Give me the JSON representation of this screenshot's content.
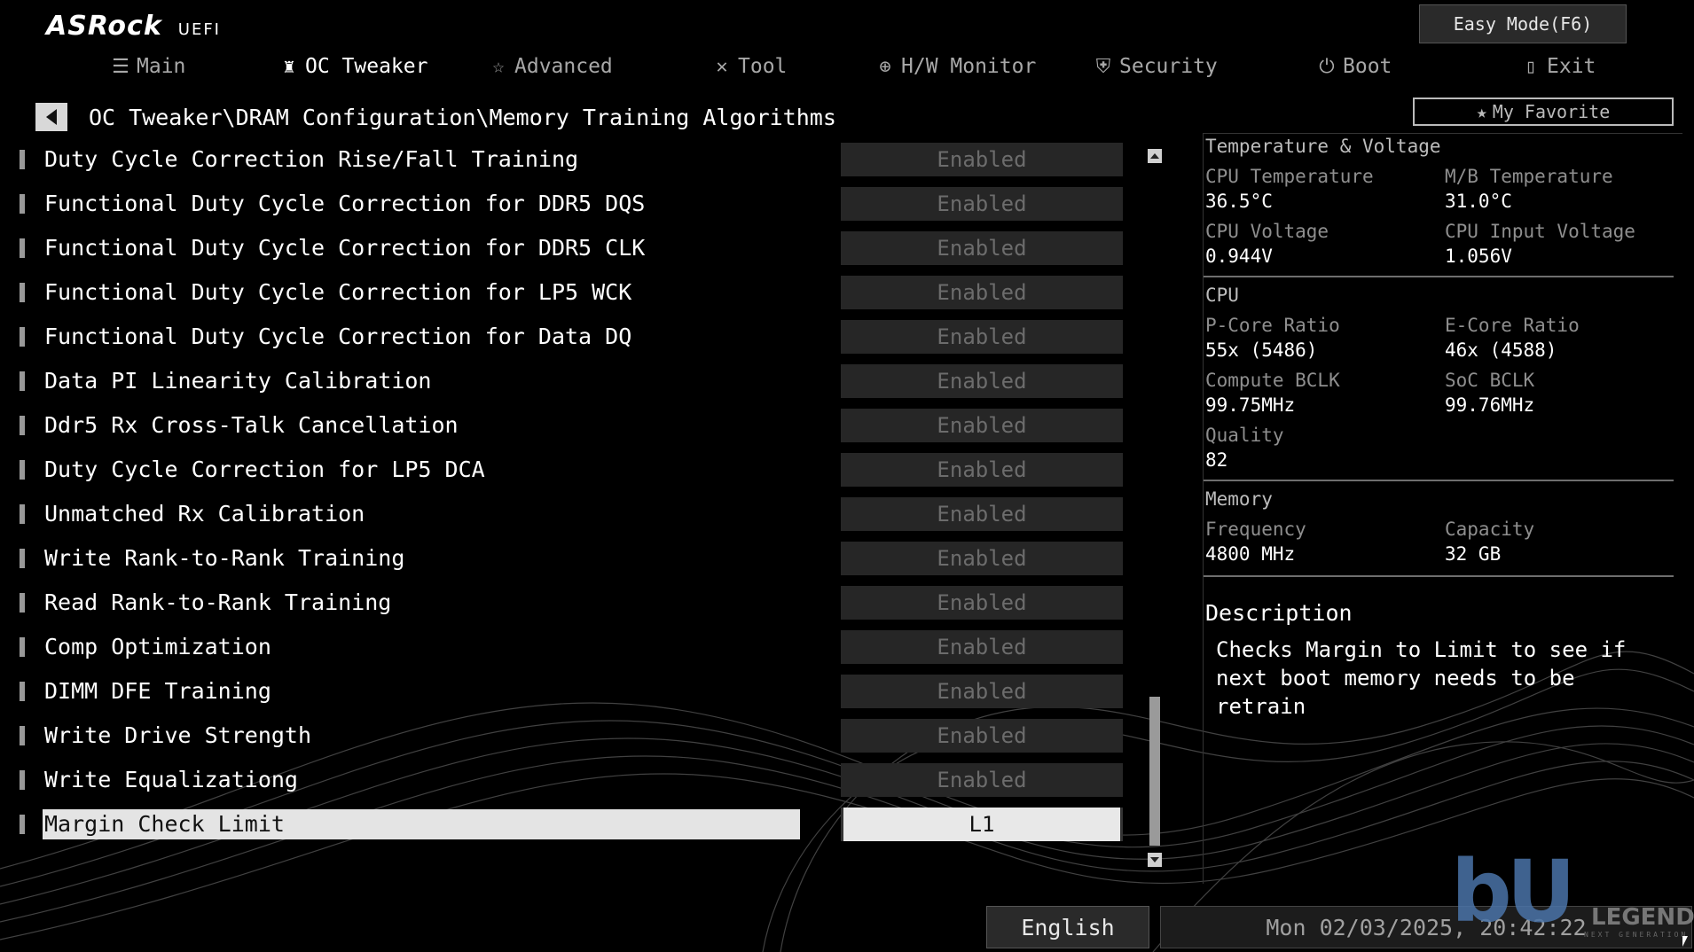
{
  "brand": {
    "logo": "ASRock",
    "sub": "UEFI"
  },
  "easy_mode_label": "Easy Mode(F6)",
  "nav": [
    {
      "label": "Main",
      "icon": "list-icon",
      "active": false
    },
    {
      "label": "OC Tweaker",
      "icon": "rocket-icon",
      "active": true
    },
    {
      "label": "Advanced",
      "icon": "star-icon",
      "active": false
    },
    {
      "label": "Tool",
      "icon": "tools-icon",
      "active": false
    },
    {
      "label": "H/W Monitor",
      "icon": "crosshair-icon",
      "active": false
    },
    {
      "label": "Security",
      "icon": "shield-icon",
      "active": false
    },
    {
      "label": "Boot",
      "icon": "power-icon",
      "active": false
    },
    {
      "label": "Exit",
      "icon": "door-exit-icon",
      "active": false
    }
  ],
  "breadcrumb": "OC Tweaker\\DRAM Configuration\\Memory Training Algorithms",
  "my_favorite_label": "My Favorite",
  "settings": [
    {
      "label": "Duty Cycle Correction Rise/Fall Training",
      "value": "Enabled"
    },
    {
      "label": "Functional Duty Cycle Correction for DDR5 DQS",
      "value": "Enabled"
    },
    {
      "label": "Functional Duty Cycle Correction for DDR5 CLK",
      "value": "Enabled"
    },
    {
      "label": "Functional Duty Cycle Correction for LP5 WCK",
      "value": "Enabled"
    },
    {
      "label": "Functional Duty Cycle Correction for Data DQ",
      "value": "Enabled"
    },
    {
      "label": "Data PI Linearity Calibration",
      "value": "Enabled"
    },
    {
      "label": "Ddr5 Rx Cross-Talk Cancellation",
      "value": "Enabled"
    },
    {
      "label": "Duty Cycle Correction for LP5 DCA",
      "value": "Enabled"
    },
    {
      "label": "Unmatched Rx Calibration",
      "value": "Enabled"
    },
    {
      "label": "Write Rank-to-Rank Training",
      "value": "Enabled"
    },
    {
      "label": "Read Rank-to-Rank Training",
      "value": "Enabled"
    },
    {
      "label": "Comp Optimization",
      "value": "Enabled"
    },
    {
      "label": "DIMM DFE Training",
      "value": "Enabled"
    },
    {
      "label": "Write Drive Strength",
      "value": "Enabled"
    },
    {
      "label": "Write Equalizationg",
      "value": "Enabled"
    },
    {
      "label": "Margin Check Limit",
      "value": "L1",
      "selected": true
    }
  ],
  "info": {
    "temp_voltage": {
      "title": "Temperature & Voltage",
      "cpu_temp_label": "CPU Temperature",
      "cpu_temp": "36.5°C",
      "mb_temp_label": "M/B Temperature",
      "mb_temp": "31.0°C",
      "cpu_volt_label": "CPU Voltage",
      "cpu_volt": "0.944V",
      "cpu_input_volt_label": "CPU Input Voltage",
      "cpu_input_volt": "1.056V"
    },
    "cpu": {
      "title": "CPU",
      "pcore_label": "P-Core Ratio",
      "pcore": "55x (5486)",
      "ecore_label": "E-Core Ratio",
      "ecore": "46x (4588)",
      "compute_bclk_label": "Compute BCLK",
      "compute_bclk": "99.75MHz",
      "soc_bclk_label": "SoC BCLK",
      "soc_bclk": "99.76MHz",
      "quality_label": "Quality",
      "quality": "82"
    },
    "memory": {
      "title": "Memory",
      "freq_label": "Frequency",
      "freq": "4800 MHz",
      "cap_label": "Capacity",
      "cap": "32 GB"
    },
    "description": {
      "title": "Description",
      "text": "Checks Margin to Limit to see if next boot memory needs to be retrain"
    }
  },
  "footer": {
    "language": "English",
    "datetime": "Mon 02/03/2025, 20:42:22"
  },
  "watermark": {
    "letters": "bU",
    "word": "LEGEND",
    "tag": "NEXT GENERATION"
  }
}
